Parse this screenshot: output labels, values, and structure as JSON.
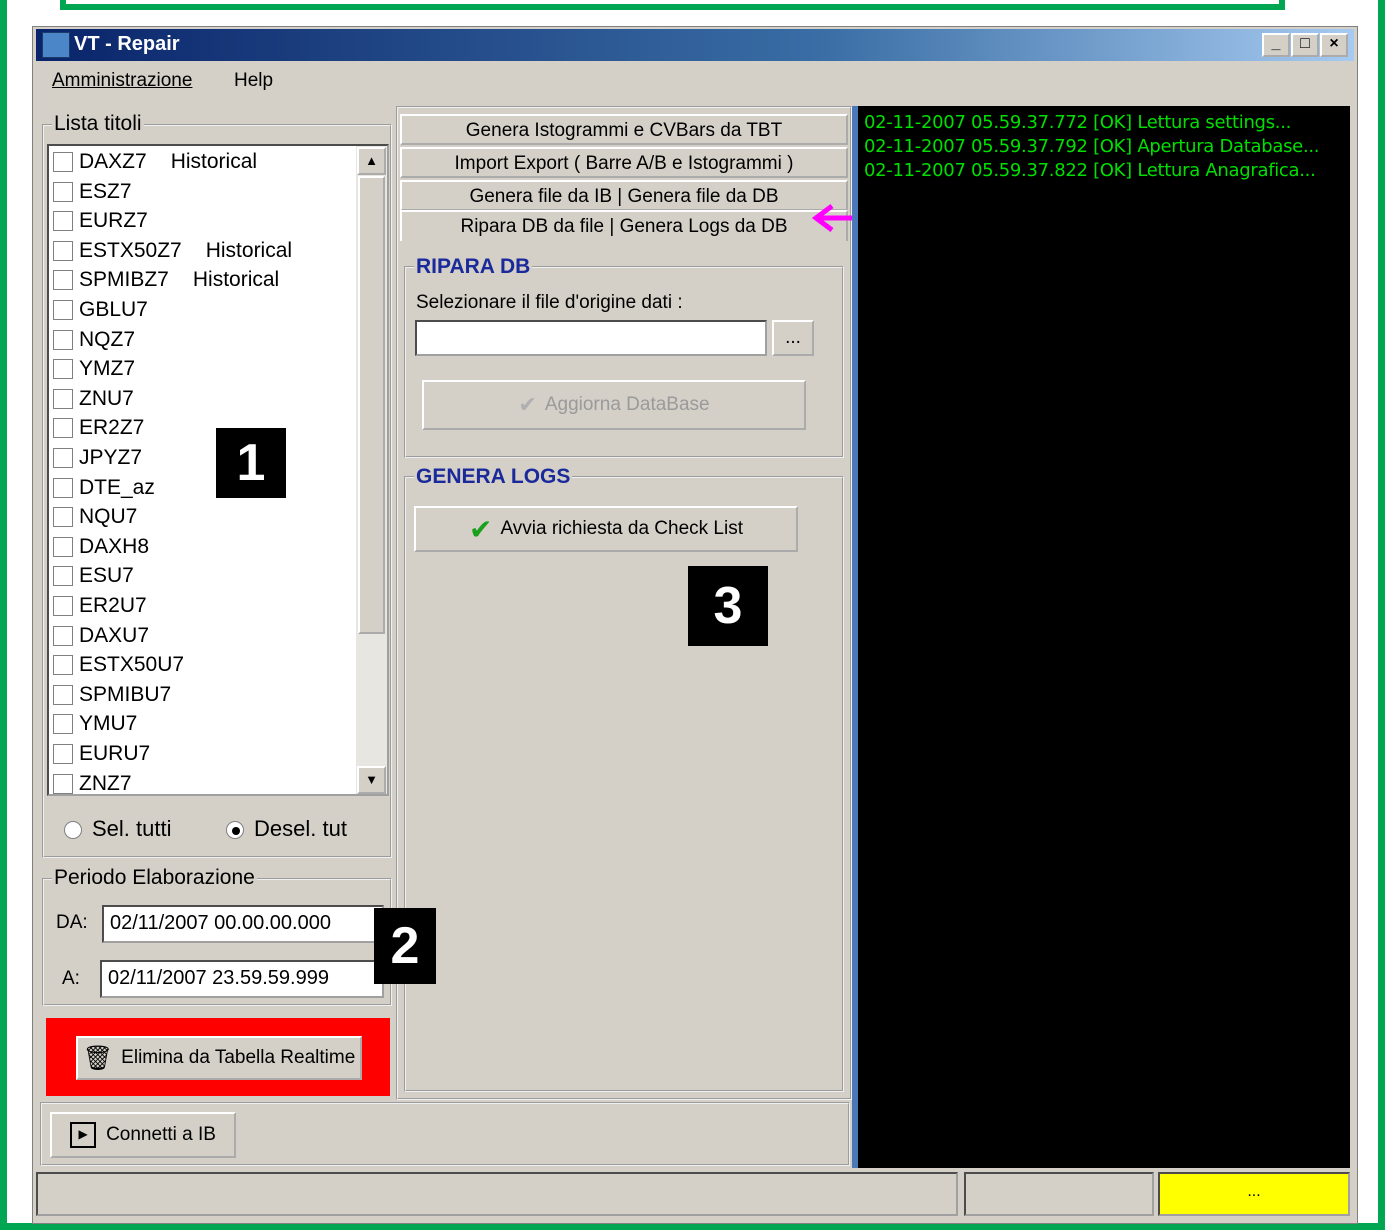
{
  "window": {
    "title": "VT - Repair",
    "min": "_",
    "max": "□",
    "close": "×"
  },
  "menu": {
    "admin": "Amministrazione",
    "help": "Help"
  },
  "lista": {
    "label": "Lista titoli",
    "items": [
      {
        "name": "DAXZ7",
        "tag": "Historical"
      },
      {
        "name": "ESZ7",
        "tag": ""
      },
      {
        "name": "EURZ7",
        "tag": ""
      },
      {
        "name": "ESTX50Z7",
        "tag": "Historical"
      },
      {
        "name": "SPMIBZ7",
        "tag": "Historical"
      },
      {
        "name": "GBLU7",
        "tag": ""
      },
      {
        "name": "NQZ7",
        "tag": ""
      },
      {
        "name": "YMZ7",
        "tag": ""
      },
      {
        "name": "ZNU7",
        "tag": ""
      },
      {
        "name": "ER2Z7",
        "tag": ""
      },
      {
        "name": "JPYZ7",
        "tag": ""
      },
      {
        "name": "DTE_az",
        "tag": ""
      },
      {
        "name": "NQU7",
        "tag": ""
      },
      {
        "name": "DAXH8",
        "tag": ""
      },
      {
        "name": "ESU7",
        "tag": ""
      },
      {
        "name": "ER2U7",
        "tag": ""
      },
      {
        "name": "DAXU7",
        "tag": ""
      },
      {
        "name": "ESTX50U7",
        "tag": ""
      },
      {
        "name": "SPMIBU7",
        "tag": ""
      },
      {
        "name": "YMU7",
        "tag": ""
      },
      {
        "name": "EURU7",
        "tag": ""
      },
      {
        "name": "ZNZ7",
        "tag": ""
      }
    ],
    "sel_all": "Sel. tutti",
    "desel_all": "Desel. tut",
    "selected_radio": "desel_all"
  },
  "periodo": {
    "label": "Periodo Elaborazione",
    "da_label": "DA:",
    "da_value": "02/11/2007 00.00.00.000",
    "a_label": "A:",
    "a_value": "02/11/2007 23.59.59.999"
  },
  "elimina_button": "Elimina da Tabella Realtime",
  "connetti_button": "Connetti a IB",
  "tabs": [
    "Genera Istogrammi e CVBars da TBT",
    "Import Export ( Barre A/B e Istogrammi )",
    "Genera file da IB | Genera file da DB",
    "Ripara DB da file | Genera Logs da DB"
  ],
  "ripara": {
    "label": "RIPARA DB",
    "file_prompt": "Selezionare il file d'origine dati :",
    "file_value": "",
    "browse": "...",
    "update_button": "Aggiorna DataBase"
  },
  "logs": {
    "label": "GENERA LOGS",
    "start_button": "Avvia richiesta da Check List"
  },
  "console": [
    "02-11-2007 05.59.37.772 [OK] Lettura settings...",
    "02-11-2007 05.59.37.792 [OK] Apertura Database...",
    "02-11-2007 05.59.37.822 [OK] Lettura Anagrafica..."
  ],
  "callouts": {
    "one": "1",
    "two": "2",
    "three": "3"
  },
  "statusbar": {
    "indicator": "..."
  },
  "colors": {
    "frame": "#00a651",
    "console_text": "#00e000",
    "elimina_bg": "#ff0000",
    "indicator": "#ffff00",
    "arrow": "#ff00ff",
    "section_title": "#1a2a9a"
  }
}
